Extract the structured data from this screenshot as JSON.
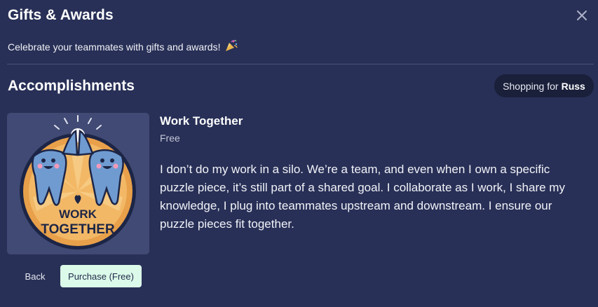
{
  "dialog": {
    "title": "Gifts & Awards",
    "subtitle": "Celebrate your teammates with gifts and awards!",
    "close_icon": "close-icon",
    "subtitle_icon": "party-popper-icon"
  },
  "section": {
    "title": "Accomplishments",
    "shopping_prefix": "Shopping for",
    "shopping_name": "Russ"
  },
  "item": {
    "image_text_line1": "WORK",
    "image_text_line2": "TOGETHER",
    "title": "Work Together",
    "price": "Free",
    "description": "I don’t do my work in a silo. We’re a team, and even when I own a specific puzzle piece, it’s still part of a shared goal. I collaborate as I work, I share my knowledge, I plug into teammates upstream and downstream. I ensure our puzzle pieces fit together."
  },
  "actions": {
    "back_label": "Back",
    "purchase_label": "Purchase (Free)"
  },
  "colors": {
    "background": "#283057",
    "pill_background": "#1a1f3a",
    "purchase_button": "#dcfae9",
    "badge_gold": "#e8a04a"
  }
}
